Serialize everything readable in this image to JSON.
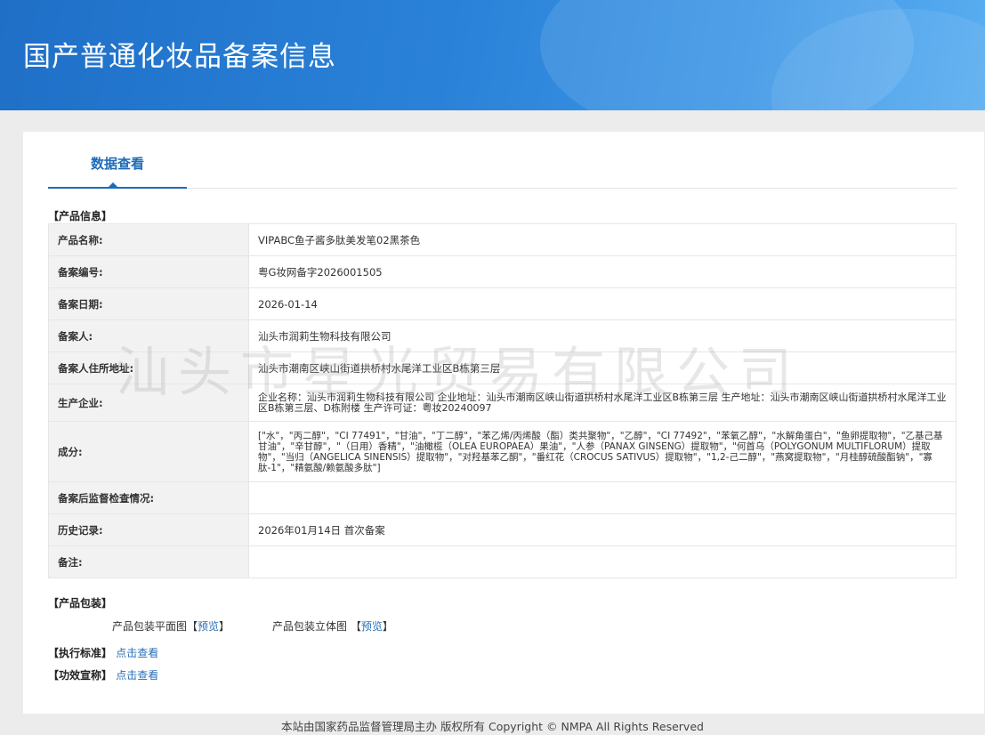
{
  "header": {
    "title": "国产普通化妆品备案信息"
  },
  "tabs": [
    {
      "label": "数据查看"
    }
  ],
  "product_info": {
    "section_title": "【产品信息】",
    "rows": [
      {
        "key": "产品名称:",
        "value": "VIPABC鱼子酱多肽美发笔02黑茶色"
      },
      {
        "key": "备案编号:",
        "value": "粤G妆网备字2026001505"
      },
      {
        "key": "备案日期:",
        "value": "2026-01-14"
      },
      {
        "key": "备案人:",
        "value": "汕头市润莉生物科技有限公司"
      },
      {
        "key": "备案人住所地址:",
        "value": "汕头市潮南区峡山街道拱桥村水尾洋工业区B栋第三层"
      },
      {
        "key": "生产企业:",
        "value": "企业名称：汕头市润莉生物科技有限公司 企业地址：汕头市潮南区峡山街道拱桥村水尾洋工业区B栋第三层 生产地址：汕头市潮南区峡山街道拱桥村水尾洋工业区B栋第三层、D栋附楼 生产许可证：粤妆20240097"
      },
      {
        "key": "成分:",
        "value": "[\"水\"，\"丙二醇\"，\"CI 77491\"，\"甘油\"，\"丁二醇\"，\"苯乙烯/丙烯酸（酯）类共聚物\"，\"乙醇\"，\"CI 77492\"，\"苯氧乙醇\"，\"水解角蛋白\"，\"鱼卵提取物\"，\"乙基己基甘油\"，\"辛甘醇\"，\"（日用）香精\"，\"油橄榄（OLEA EUROPAEA）果油\"，\"人参（PANAX GINSENG）提取物\"，\"何首乌（POLYGONUM MULTIFLORUM）提取物\"，\"当归（ANGELICA SINENSIS）提取物\"，\"对羟基苯乙酮\"，\"番红花（CROCUS SATIVUS）提取物\"，\"1,2-己二醇\"，\"燕窝提取物\"，\"月桂醇硫酸酯钠\"，\"寡肽-1\"，\"精氨酸/赖氨酸多肽\"]"
      },
      {
        "key": "备案后监督检查情况:",
        "value": ""
      },
      {
        "key": "历史记录:",
        "value": "2026年01月14日 首次备案"
      },
      {
        "key": "备注:",
        "value": ""
      }
    ]
  },
  "packaging": {
    "section_title": "【产品包装】",
    "flat_label": "产品包装平面图",
    "three_d_label": "产品包装立体图",
    "bracket_open": "【",
    "bracket_close": "】",
    "preview_link": "预览"
  },
  "standard": {
    "label": "【执行标准】",
    "link": "点击查看"
  },
  "claims": {
    "label": "【功效宣称】",
    "link": "点击查看"
  },
  "watermark": "汕头市星光贸易有限公司",
  "footer": {
    "text": "本站由国家药品监督管理局主办 版权所有 Copyright © NMPA All Rights Reserved"
  }
}
